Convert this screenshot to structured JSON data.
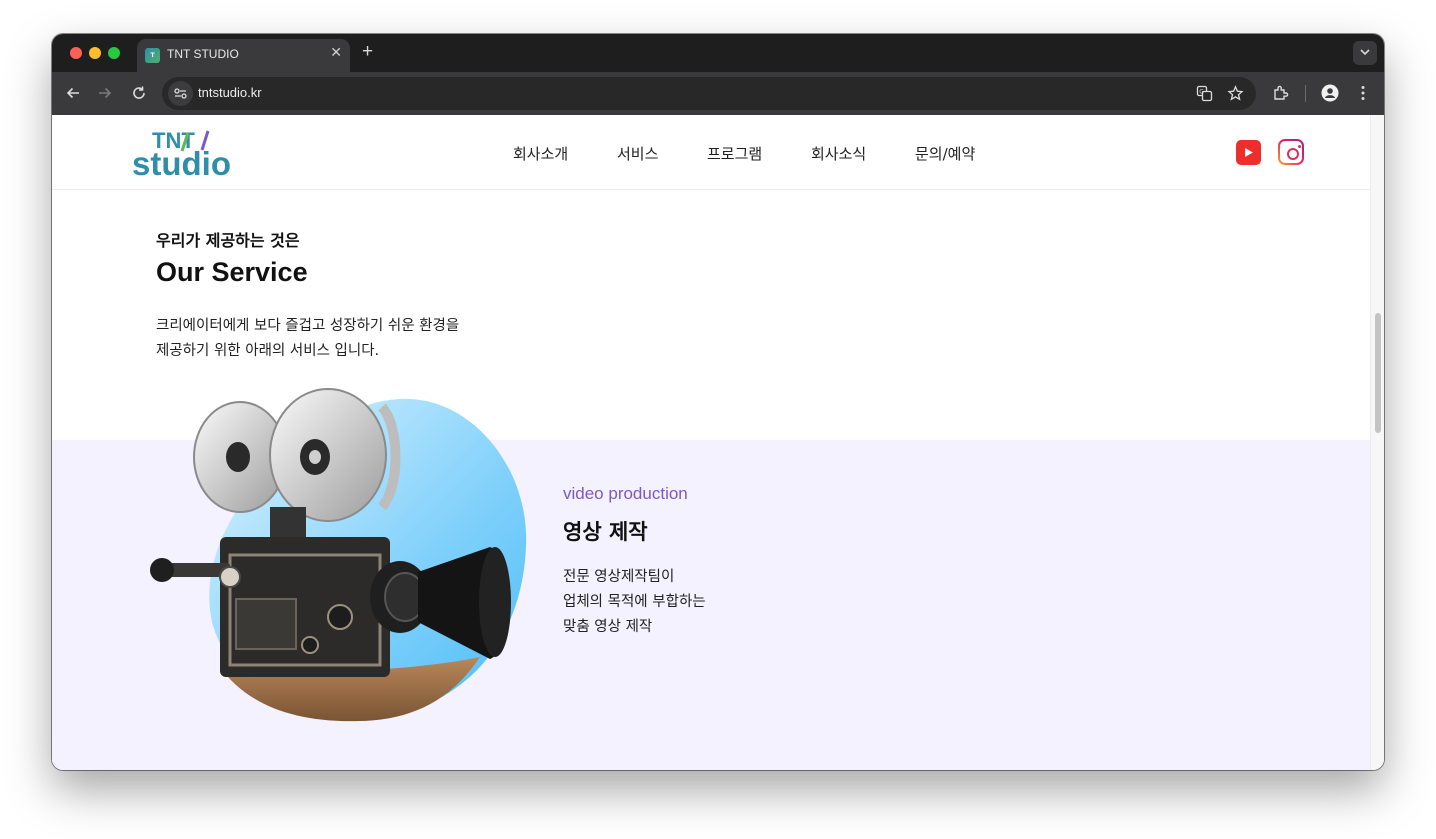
{
  "browser": {
    "tab_title": "TNT STUDIO",
    "tab_close": "✕",
    "new_tab": "+",
    "url": "tntstudio.kr"
  },
  "site": {
    "logo_top": "TNT",
    "logo_bottom": "studio",
    "nav": [
      "회사소개",
      "서비스",
      "프로그램",
      "회사소식",
      "문의/예약"
    ],
    "social": [
      "youtube-icon",
      "instagram-icon"
    ],
    "colors": {
      "accent": "#7c59c9",
      "youtube": "#ee2d2d",
      "section_bg": "#f3f2fe",
      "logo_teal": "#2f8fa8",
      "logo_green": "#5fb85a"
    }
  },
  "intro": {
    "eyebrow": "우리가 제공하는 것은",
    "title": "Our Service",
    "desc_line1": "크리에이터에게 보다 즐겁고 성장하기 쉬운 환경을",
    "desc_line2": "제공하기 위한 아래의 서비스 입니다."
  },
  "service": {
    "en_label": "video production",
    "ko_title": "영상 제작",
    "desc_lines": [
      "전문 영상제작팀이",
      "업체의 목적에 부합하는",
      "맞춤 영상 제작"
    ]
  }
}
